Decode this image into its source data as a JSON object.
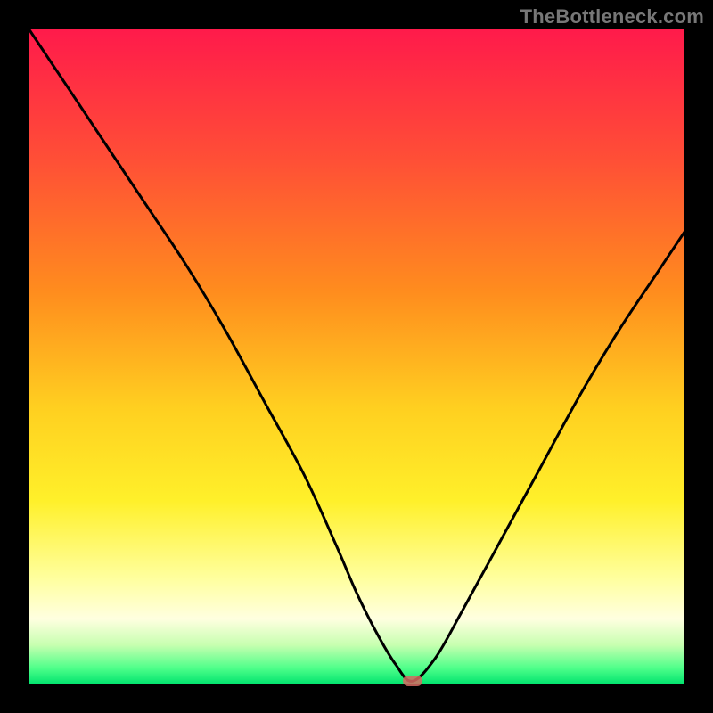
{
  "watermark": "TheBottleneck.com",
  "marker_color": "#d66a62",
  "chart_data": {
    "type": "line",
    "title": "",
    "subtitle": "",
    "xlabel": "",
    "ylabel": "",
    "legend": [],
    "xlim": [
      0,
      100
    ],
    "ylim": [
      0,
      100
    ],
    "gradient_stops": [
      {
        "offset": 0.0,
        "color": "#ff1a4b"
      },
      {
        "offset": 0.2,
        "color": "#ff4f36"
      },
      {
        "offset": 0.4,
        "color": "#ff8c1e"
      },
      {
        "offset": 0.58,
        "color": "#ffd020"
      },
      {
        "offset": 0.72,
        "color": "#fff02a"
      },
      {
        "offset": 0.84,
        "color": "#ffffa0"
      },
      {
        "offset": 0.9,
        "color": "#ffffe0"
      },
      {
        "offset": 0.94,
        "color": "#c7ffb0"
      },
      {
        "offset": 0.975,
        "color": "#4fff8a"
      },
      {
        "offset": 1.0,
        "color": "#00e36e"
      }
    ],
    "series": [
      {
        "name": "bottleneck-curve",
        "color": "#000000",
        "x": [
          0,
          6,
          12,
          18,
          24,
          30,
          36,
          42,
          47,
          50,
          53,
          56,
          58.5,
          62,
          66,
          72,
          78,
          84,
          90,
          96,
          100
        ],
        "y": [
          100,
          91,
          82,
          73,
          64,
          54,
          43,
          32,
          21,
          14,
          8,
          3,
          0.5,
          4,
          11,
          22,
          33,
          44,
          54,
          63,
          69
        ]
      }
    ],
    "annotations": [
      {
        "name": "minimum-marker",
        "x": 58.5,
        "y": 0.5,
        "color": "#d66a62"
      }
    ]
  }
}
